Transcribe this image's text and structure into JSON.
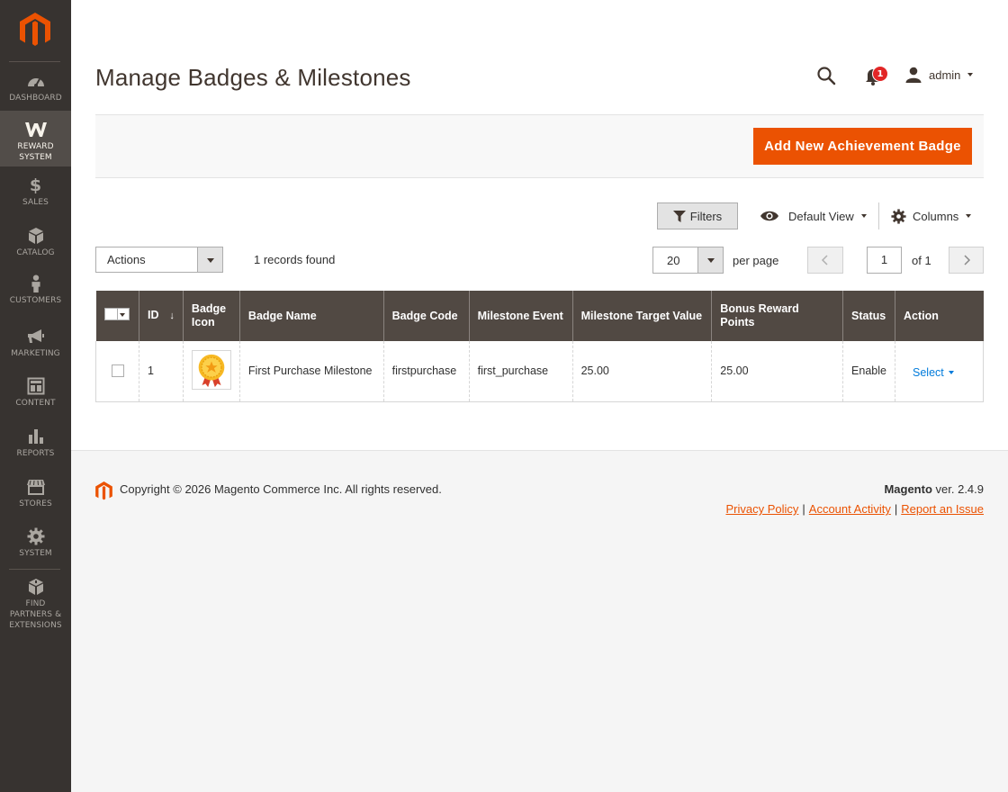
{
  "sidebar": {
    "items": [
      {
        "label": "DASHBOARD",
        "icon": "dashboard-icon"
      },
      {
        "label": "REWARD SYSTEM",
        "icon": "reward-icon",
        "active": true
      },
      {
        "label": "SALES",
        "icon": "dollar-icon"
      },
      {
        "label": "CATALOG",
        "icon": "cube-icon"
      },
      {
        "label": "CUSTOMERS",
        "icon": "person-icon"
      },
      {
        "label": "MARKETING",
        "icon": "megaphone-icon"
      },
      {
        "label": "CONTENT",
        "icon": "content-icon"
      },
      {
        "label": "REPORTS",
        "icon": "bar-chart-icon"
      },
      {
        "label": "STORES",
        "icon": "store-icon"
      },
      {
        "label": "SYSTEM",
        "icon": "gear-icon"
      },
      {
        "label": "FIND PARTNERS & EXTENSIONS",
        "icon": "box-icon"
      }
    ]
  },
  "header": {
    "title": "Manage Badges & Milestones",
    "notification_count": "1",
    "user": "admin"
  },
  "actions": {
    "add_button": "Add New Achievement Badge"
  },
  "toolbar": {
    "filters": "Filters",
    "view": "Default View",
    "columns": "Columns",
    "mass_actions": "Actions",
    "records": "1 records found",
    "per_page_value": "20",
    "per_page_label": "per page",
    "page": "1",
    "of_pages": "of 1"
  },
  "grid": {
    "columns": [
      "ID",
      "Badge Icon",
      "Badge Name",
      "Badge Code",
      "Milestone Event",
      "Milestone Target Value",
      "Bonus Reward Points",
      "Status",
      "Action"
    ],
    "sort_indicator": "↓",
    "rows": [
      {
        "id": "1",
        "badge_name": "First Purchase Milestone",
        "badge_code": "firstpurchase",
        "milestone_event": "first_purchase",
        "target_value": "25.00",
        "bonus_points": "25.00",
        "status": "Enable",
        "action": "Select"
      }
    ]
  },
  "footer": {
    "copyright": "Copyright © 2026 Magento Commerce Inc. All rights reserved.",
    "brand": "Magento",
    "version": " ver. 2.4.9",
    "links": [
      "Privacy Policy",
      "Account Activity",
      "Report an Issue"
    ],
    "separator": "|"
  },
  "colors": {
    "sidebar_bg": "#373330",
    "accent": "#eb5202",
    "grid_header": "#514943",
    "link": "#007bdb"
  }
}
